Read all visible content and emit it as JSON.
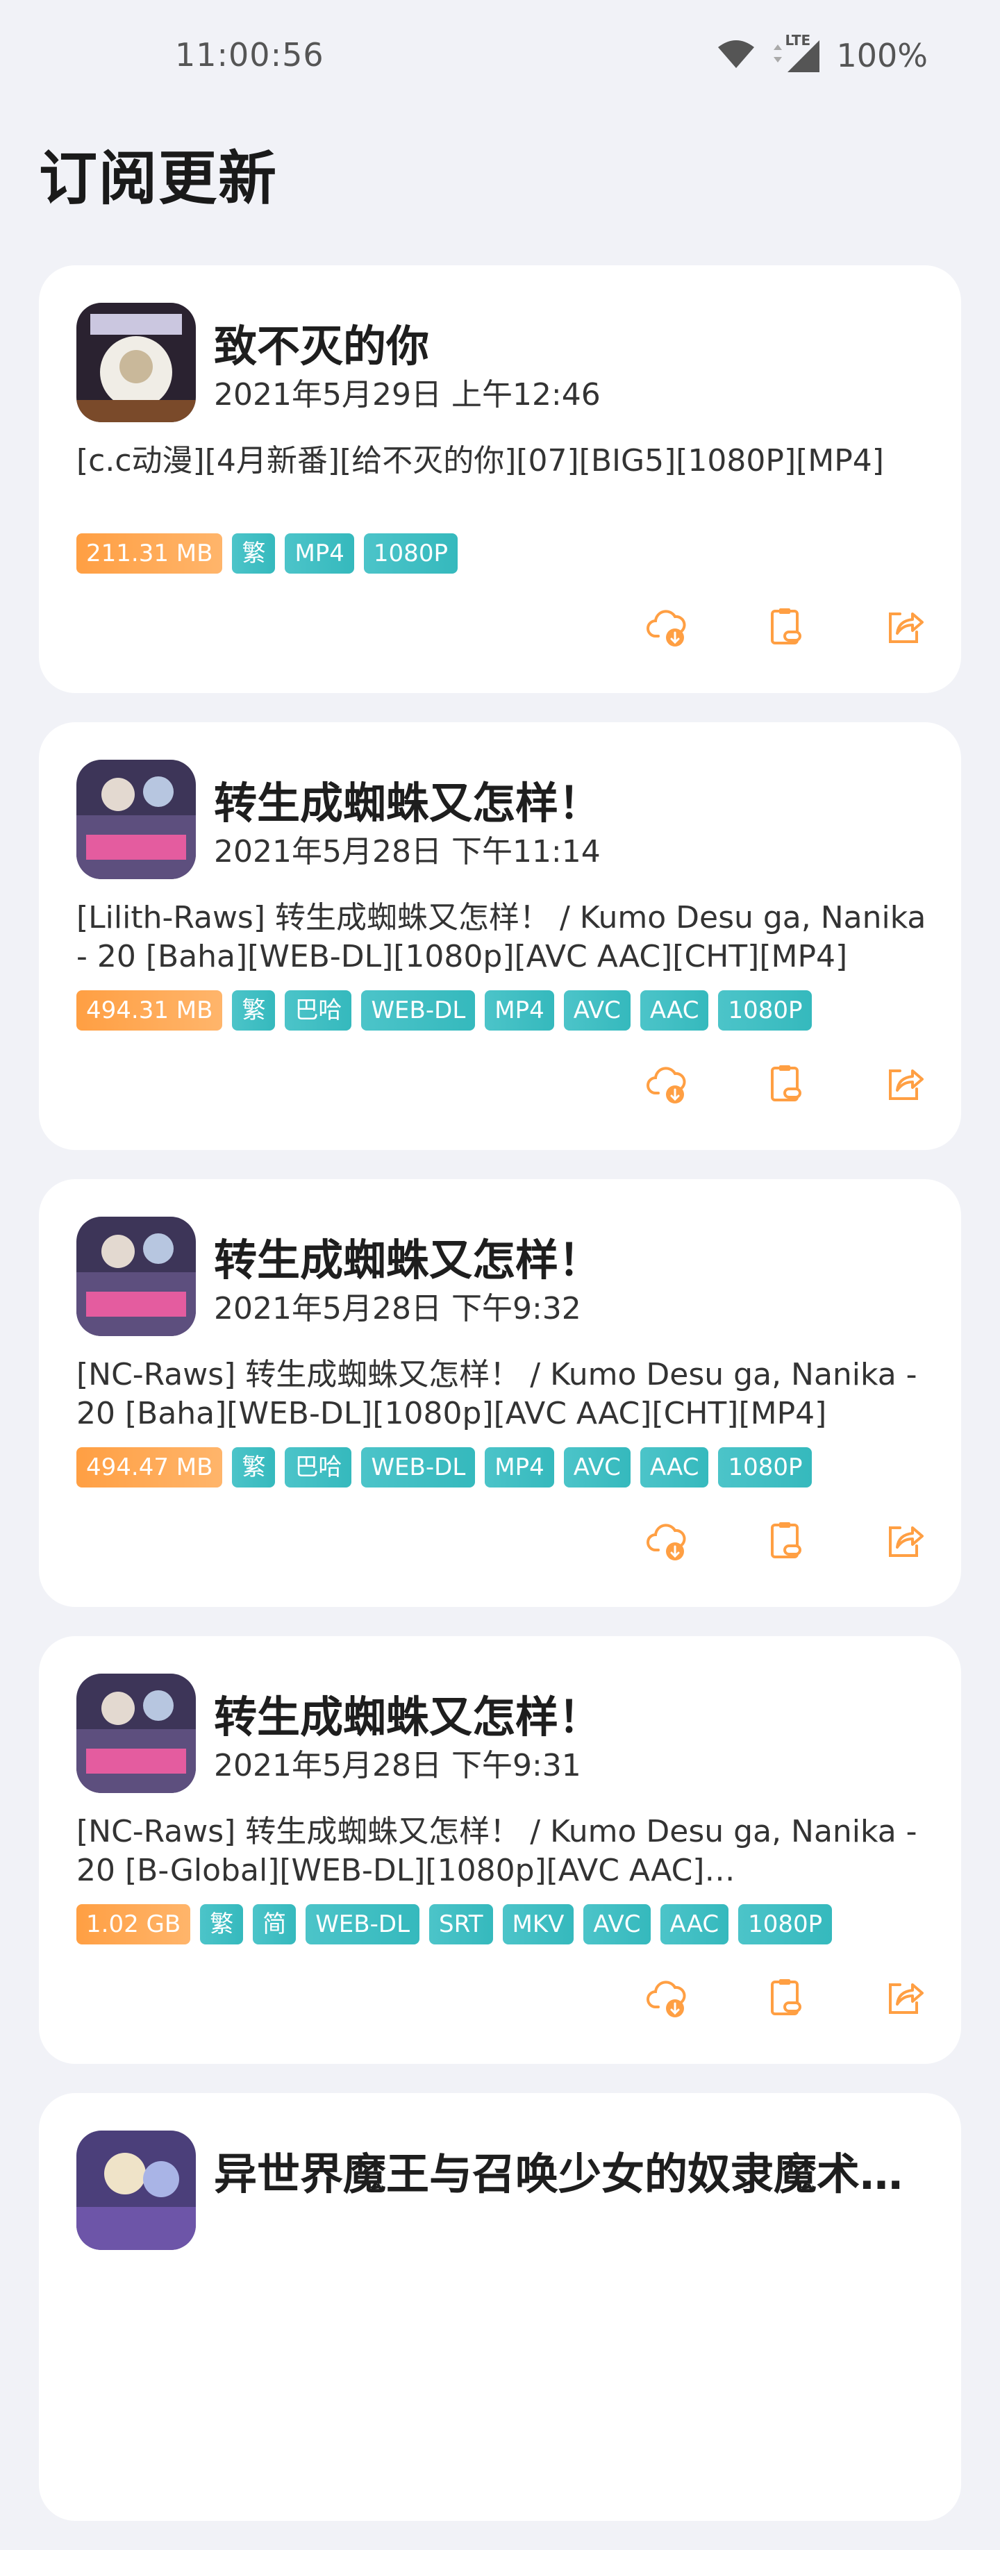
{
  "status_bar": {
    "time": "11:00:56",
    "network": "LTE",
    "battery": "100%"
  },
  "page_title": "订阅更新",
  "cards": [
    {
      "title": "致不灭的你",
      "date": "2021年5月29日 上午12:46",
      "description": "[c.c动漫][4月新番][给不灭的你][07][BIG5][1080P][MP4]",
      "tags": [
        "211.31 MB",
        "繁",
        "MP4",
        "1080P"
      ]
    },
    {
      "title": "转生成蜘蛛又怎样！",
      "date": "2021年5月28日 下午11:14",
      "description": "[Lilith-Raws] 转生成蜘蛛又怎样！ / Kumo Desu ga, Nanika - 20 [Baha][WEB-DL][1080p][AVC AAC][CHT][MP4]",
      "tags": [
        "494.31 MB",
        "繁",
        "巴哈",
        "WEB-DL",
        "MP4",
        "AVC",
        "AAC",
        "1080P"
      ]
    },
    {
      "title": "转生成蜘蛛又怎样！",
      "date": "2021年5月28日 下午9:32",
      "description": "[NC-Raws] 转生成蜘蛛又怎样！ / Kumo Desu ga, Nanika - 20 [Baha][WEB-DL][1080p][AVC AAC][CHT][MP4]",
      "tags": [
        "494.47 MB",
        "繁",
        "巴哈",
        "WEB-DL",
        "MP4",
        "AVC",
        "AAC",
        "1080P"
      ]
    },
    {
      "title": "转生成蜘蛛又怎样！",
      "date": "2021年5月28日 下午9:31",
      "description": "[NC-Raws] 转生成蜘蛛又怎样！ / Kumo Desu ga, Nanika - 20 [B-Global][WEB-DL][1080p][AVC AAC]…",
      "tags": [
        "1.02 GB",
        "繁",
        "简",
        "WEB-DL",
        "SRT",
        "MKV",
        "AVC",
        "AAC",
        "1080P"
      ]
    },
    {
      "title": "异世界魔王与召唤少女的奴隶魔术…",
      "date": "",
      "description": "",
      "tags": []
    }
  ],
  "colors": {
    "accent_orange": "#ff9f43",
    "tag_teal": "#3fbfc4",
    "background": "#f1f2f7"
  },
  "icons": {
    "download": "cloud-download-icon",
    "copy": "clipboard-link-icon",
    "share": "share-icon"
  }
}
